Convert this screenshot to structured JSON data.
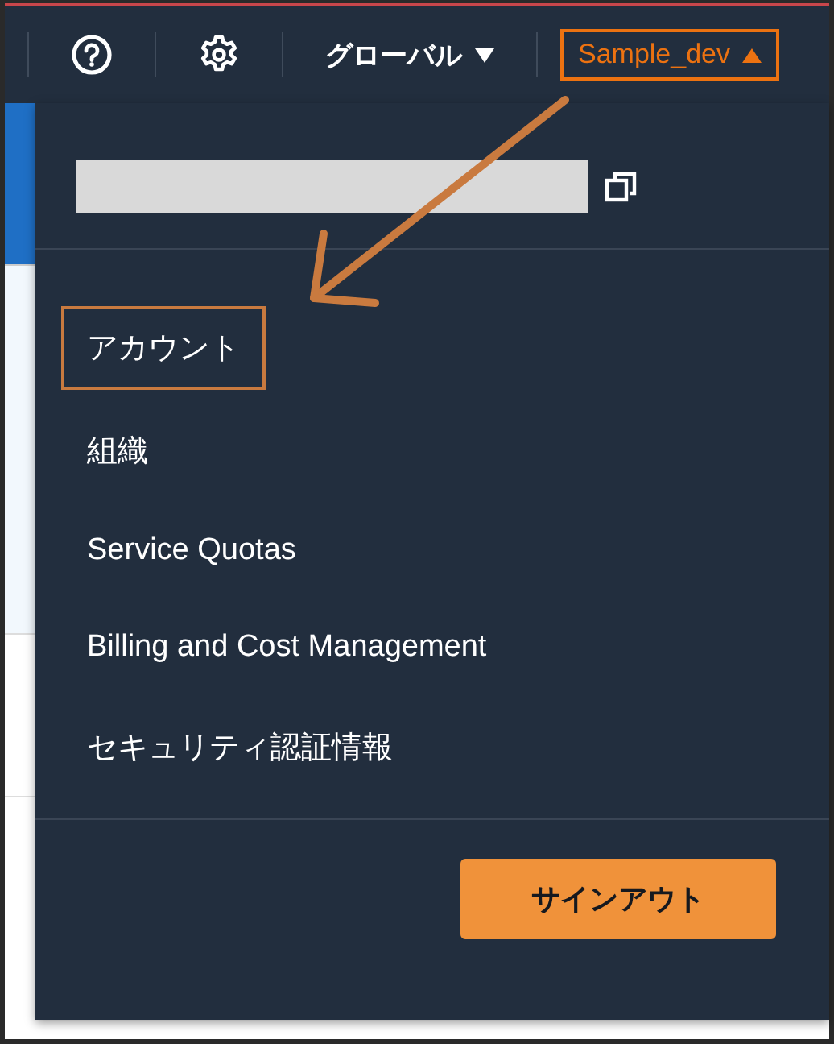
{
  "top_bar": {
    "region_selector": {
      "label": "グローバル"
    },
    "account_button": {
      "label": "Sample_dev",
      "expanded": true
    }
  },
  "account_menu": {
    "items": [
      {
        "label": "アカウント",
        "highlighted": true
      },
      {
        "label": "組織",
        "highlighted": false
      },
      {
        "label": "Service Quotas",
        "highlighted": false
      },
      {
        "label": "Billing and Cost Management",
        "highlighted": false
      },
      {
        "label": "セキュリティ認証情報",
        "highlighted": false
      }
    ],
    "sign_out_button": "サインアウト"
  }
}
